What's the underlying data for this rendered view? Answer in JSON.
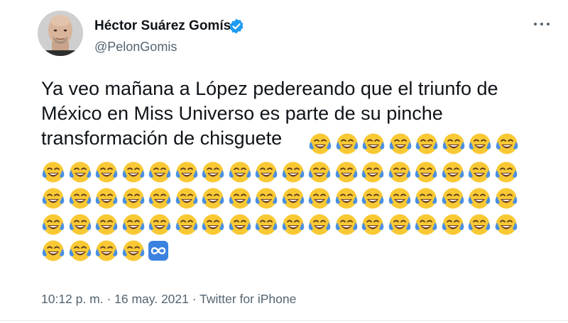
{
  "tweet": {
    "author": {
      "display_name": "Héctor Suárez Gomís",
      "handle": "@PelonGomis",
      "verified": true
    },
    "text_lines": [
      "Ya veo mañana a López pedereando que el triunfo de",
      "México en Miss Universo es parte de su pinche",
      "transformación de chisguete"
    ],
    "emoji": {
      "name": "face-with-tears-of-joy",
      "count_first_line": 8,
      "count_full_rows": 18,
      "full_rows": 3,
      "count_last_row": 4,
      "trailing_icon": "infinity-loop-icon"
    },
    "meta": {
      "time": "10:12 p. m.",
      "separator": "·",
      "date": "16 may. 2021",
      "source": "Twitter for iPhone"
    },
    "colors": {
      "text": "#0f1419",
      "secondary": "#536471",
      "verified": "#1d9bf0",
      "emoji_face": "#f9c935",
      "emoji_tear": "#4a90e2"
    }
  }
}
